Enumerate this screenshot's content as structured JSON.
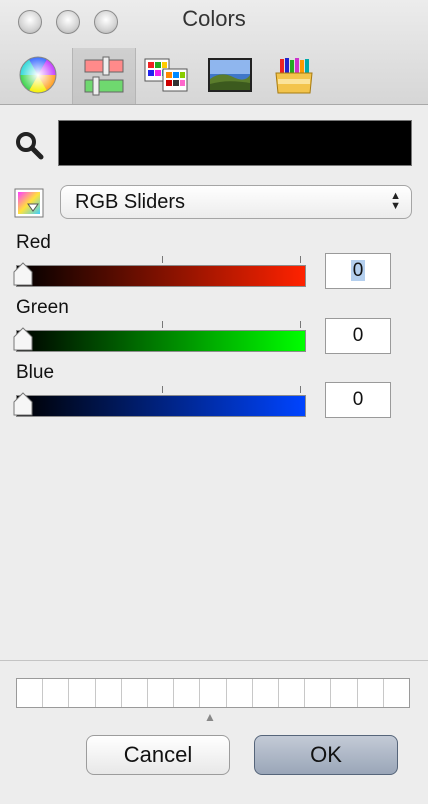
{
  "window": {
    "title": "Colors"
  },
  "toolbar": {
    "modes": [
      {
        "icon": "color-wheel-icon"
      },
      {
        "icon": "color-sliders-icon",
        "active": true
      },
      {
        "icon": "color-palettes-icon"
      },
      {
        "icon": "image-palettes-icon"
      },
      {
        "icon": "crayons-icon"
      }
    ]
  },
  "search": {
    "icon": "magnifier-icon",
    "current_color": "#000000"
  },
  "mode_select": {
    "selected": "RGB Sliders",
    "icon": "color-picker-icon"
  },
  "sliders": [
    {
      "label": "Red",
      "value": "0",
      "color": "#ff2200"
    },
    {
      "label": "Green",
      "value": "0",
      "color": "#00ff00"
    },
    {
      "label": "Blue",
      "value": "0",
      "color": "#0044ff"
    }
  ],
  "buttons": {
    "cancel": "Cancel",
    "ok": "OK"
  }
}
